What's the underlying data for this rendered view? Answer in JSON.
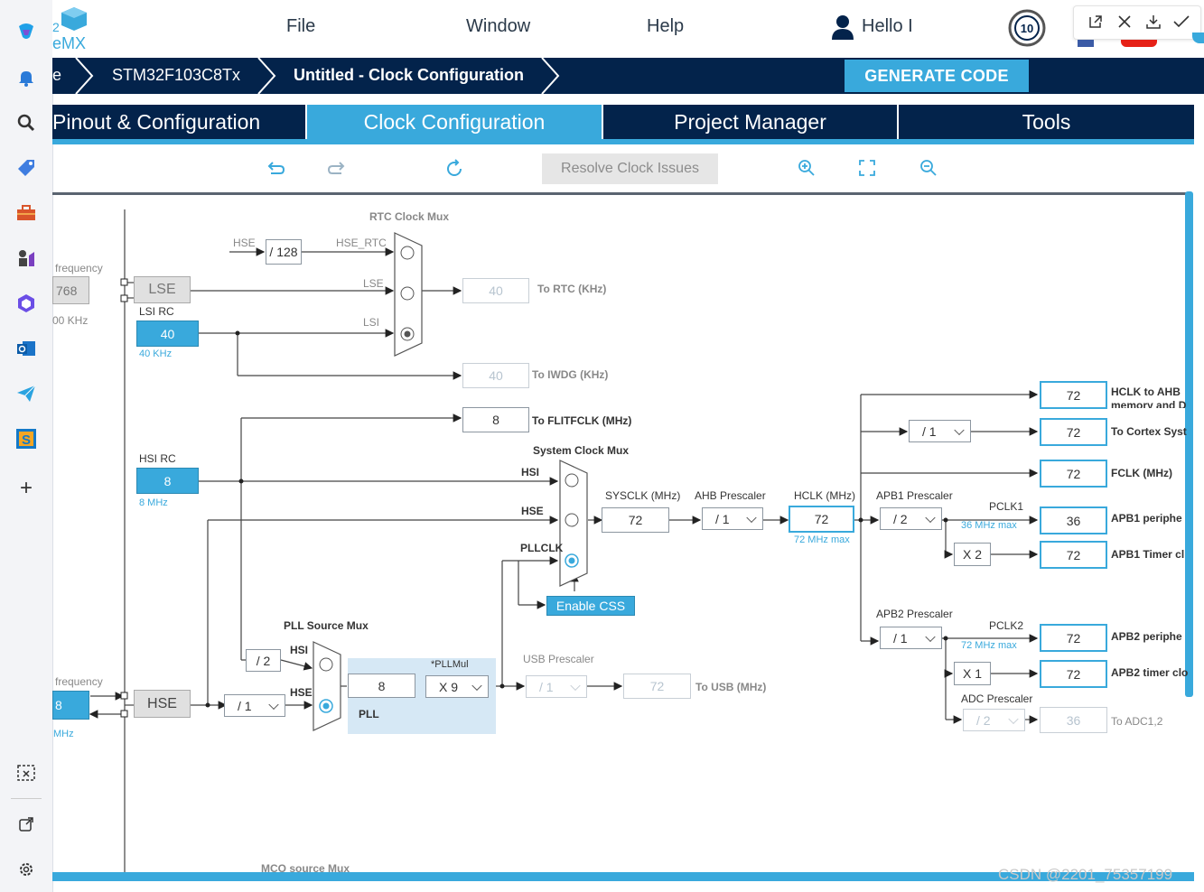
{
  "sidebar_edge": {
    "icons": [
      "copilot-icon",
      "bell-icon",
      "search-icon",
      "tag-icon",
      "toolbox-icon",
      "chess-icon",
      "office-icon",
      "outlook-icon",
      "send-icon",
      "s-app-icon",
      "plus-icon",
      "screenshot-icon",
      "external-link-icon",
      "settings-icon"
    ]
  },
  "logo": {
    "text_top": "2",
    "text_bottom": "eMX"
  },
  "menu": {
    "file": "File",
    "window": "Window",
    "help": "Help",
    "user": "Hello I"
  },
  "browser_controls": [
    "open-external-icon",
    "close-icon",
    "download-icon",
    "check-icon"
  ],
  "breadcrumb": {
    "first": "e",
    "chip": "STM32F103C8Tx",
    "page": "Untitled - Clock Configuration",
    "generate": "GENERATE CODE"
  },
  "tabs": [
    {
      "label": "Pinout & Configuration",
      "active": false
    },
    {
      "label": "Clock Configuration",
      "active": true
    },
    {
      "label": "Project Manager",
      "active": false
    },
    {
      "label": "Tools",
      "active": false
    }
  ],
  "toolbar": {
    "resolve": "Resolve Clock Issues"
  },
  "clock": {
    "rtc_mux_title": "RTC Clock Mux",
    "hse_label": "HSE",
    "div128": "/ 128",
    "hse_rtc": "HSE_RTC",
    "lse_input_label": "LSE",
    "lsi_input_label": "LSI",
    "freq_label_top": "frequency",
    "lse_freq": "768",
    "lse_khz": "00 KHz",
    "lse_box": "LSE",
    "lsi_rc": "LSI RC",
    "lsi_value": "40",
    "lsi_khz": "40 KHz",
    "to_rtc_value": "40",
    "to_rtc": "To RTC (KHz)",
    "to_iwdg_value": "40",
    "to_iwdg": "To IWDG (KHz)",
    "flitf_value": "8",
    "to_flitf": "To FLITFCLK (MHz)",
    "hsi_rc": "HSI RC",
    "hsi_value": "8",
    "hsi_mhz": "8 MHz",
    "sys_mux_title": "System Clock Mux",
    "hsi_in": "HSI",
    "hse_in": "HSE",
    "pllclk_in": "PLLCLK",
    "enable_css": "Enable CSS",
    "sysclk_label": "SYSCLK (MHz)",
    "sysclk_value": "72",
    "ahb_label": "AHB Prescaler",
    "ahb_value": "/ 1",
    "hclk_label": "HCLK (MHz)",
    "hclk_value": "72",
    "hclk_max": "72 MHz max",
    "apb1_label": "APB1 Prescaler",
    "apb1_value": "/ 2",
    "pclk1": "PCLK1",
    "pclk1_max": "36 MHz max",
    "x2": "X 2",
    "apb2_label": "APB2 Prescaler",
    "apb2_value": "/ 1",
    "pclk2": "PCLK2",
    "pclk2_max": "72 MHz max",
    "x1": "X 1",
    "adc_label": "ADC Prescaler",
    "adc_value": "/ 2",
    "cortex_div": "/ 1",
    "outputs": [
      {
        "value": "72",
        "label": "HCLK to AHB",
        "sub": "memory and D"
      },
      {
        "value": "72",
        "label": "To Cortex Syst",
        "sub": ""
      },
      {
        "value": "72",
        "label": "FCLK (MHz)",
        "sub": ""
      },
      {
        "value": "36",
        "label": "APB1 periphe",
        "sub": ""
      },
      {
        "value": "72",
        "label": "APB1 Timer cl",
        "sub": ""
      },
      {
        "value": "72",
        "label": "APB2 periphe",
        "sub": ""
      },
      {
        "value": "72",
        "label": "APB2 timer clo",
        "sub": ""
      },
      {
        "value": "36",
        "label": "To ADC1,2",
        "sub": ""
      }
    ],
    "pll_src_title": "PLL Source Mux",
    "div2": "/ 2",
    "hsi_pll": "HSI",
    "hse_pll": "HSE",
    "pll_in_value": "8",
    "pllmul_label": "*PLLMul",
    "pllmul_value": "X 9",
    "pll_label": "PLL",
    "usb_label": "USB Prescaler",
    "usb_div": "/ 1",
    "usb_value": "72",
    "to_usb": "To USB (MHz)",
    "freq_label_bottom": "frequency",
    "hse_freq": "8",
    "hse_mhz": "MHz",
    "hse_box": "HSE",
    "hse_div": "/ 1",
    "mco_label": "MCO source Mux"
  },
  "watermark": "CSDN @2201_75357199"
}
